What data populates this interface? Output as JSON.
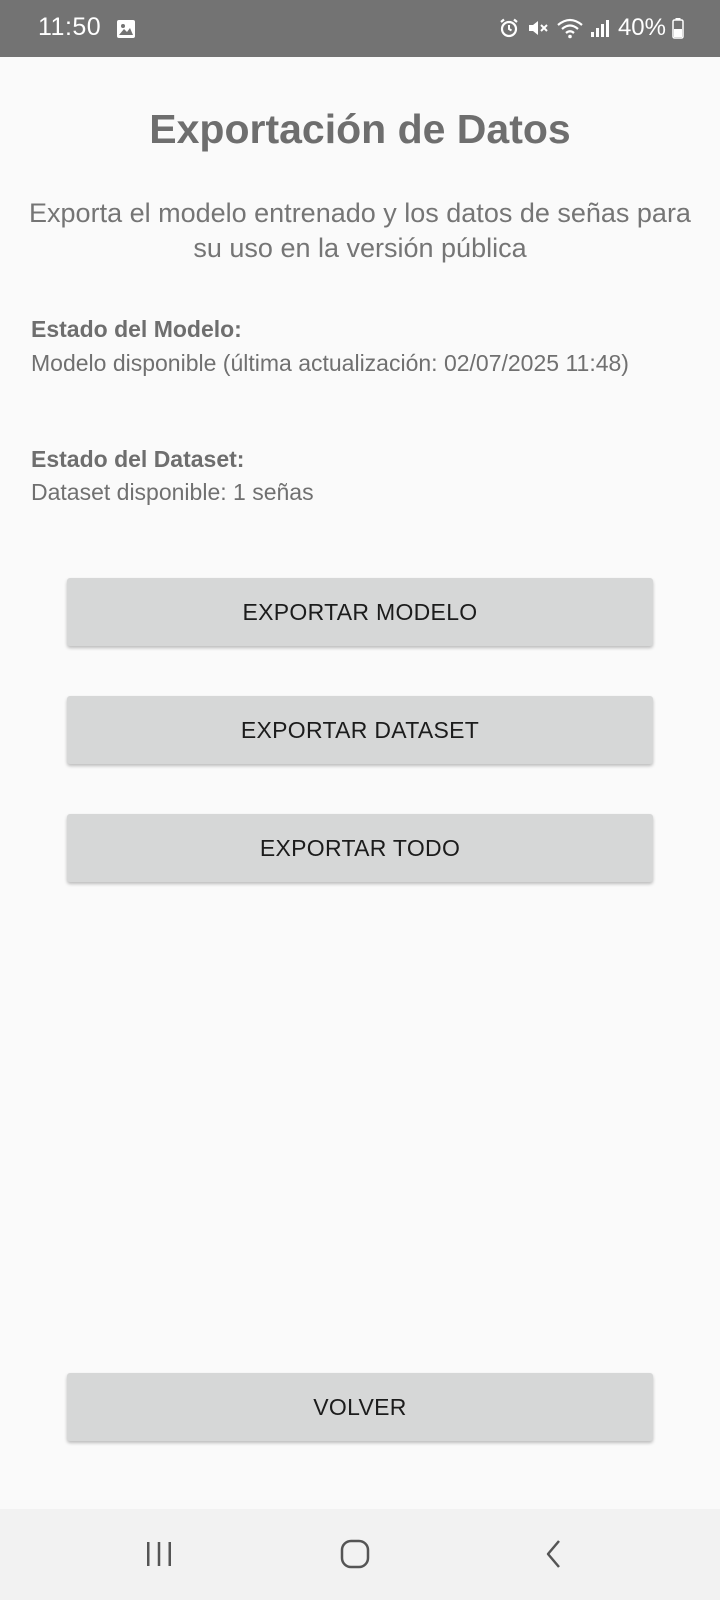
{
  "status_bar": {
    "time": "11:50",
    "battery": "40%",
    "icons": [
      "gallery-icon",
      "alarm-icon",
      "mute-icon",
      "wifi-icon",
      "signal-icon",
      "battery-icon"
    ]
  },
  "screen": {
    "title": "Exportación de Datos",
    "subtitle": "Exporta el modelo entrenado y los datos de señas para su uso en la versión pública"
  },
  "model_status": {
    "label": "Estado del Modelo:",
    "value": "Modelo disponible (última actualización: 02/07/2025 11:48)"
  },
  "dataset_status": {
    "label": "Estado del Dataset:",
    "value": "Dataset disponible: 1 señas"
  },
  "buttons": {
    "export_model": "EXPORTAR MODELO",
    "export_dataset": "EXPORTAR DATASET",
    "export_all": "EXPORTAR TODO",
    "back": "VOLVER"
  },
  "nav_bar": {
    "items": [
      "recent-apps-icon",
      "home-icon",
      "back-icon"
    ]
  },
  "colors": {
    "status_bar": "#737373",
    "background": "#fafafa",
    "button": "#d6d7d7",
    "title_text": "#6e6e6e",
    "nav_bar": "#f2f2f2"
  }
}
